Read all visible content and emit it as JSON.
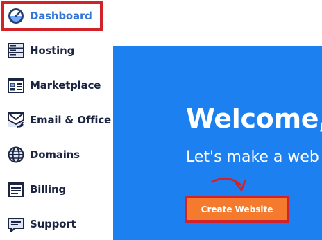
{
  "sidebar": {
    "items": [
      {
        "label": "Dashboard",
        "icon": "dashboard-gauge-icon",
        "active": true
      },
      {
        "label": "Hosting",
        "icon": "server-icon"
      },
      {
        "label": "Marketplace",
        "icon": "marketplace-icon"
      },
      {
        "label": "Email & Office",
        "icon": "email-icon"
      },
      {
        "label": "Domains",
        "icon": "globe-icon"
      },
      {
        "label": "Billing",
        "icon": "billing-icon"
      },
      {
        "label": "Support",
        "icon": "support-chat-icon"
      }
    ]
  },
  "main": {
    "welcome_title": "Welcome,",
    "welcome_subtitle": "Let's make a web",
    "create_button_label": "Create Website"
  },
  "colors": {
    "accent_blue": "#1d80f0",
    "active_text": "#3575d3",
    "nav_text": "#1b2440",
    "button_orange": "#f47b2e",
    "highlight_red": "#d2232a"
  }
}
